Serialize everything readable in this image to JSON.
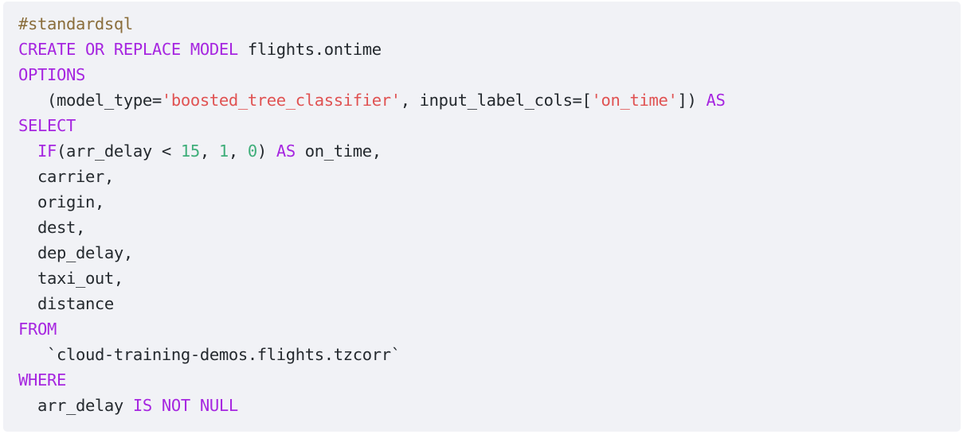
{
  "code_block": {
    "language": "sql",
    "background_color": "#f1f2f6",
    "page_background": "#ffffff",
    "token_colors": {
      "comment": "#8a6d3b",
      "keyword": "#a626e0",
      "identifier": "#6a8bd0",
      "string": "#e05252",
      "number": "#3fae7a",
      "plain": "#24292e"
    },
    "lines": [
      {
        "index": 0,
        "text": "#standardsql",
        "tokens": [
          {
            "t": "#standardsql",
            "k": "comment"
          }
        ]
      },
      {
        "index": 1,
        "text": "CREATE OR REPLACE MODEL flights.ontime",
        "tokens": [
          {
            "t": "CREATE OR REPLACE MODEL",
            "k": "keyword"
          },
          {
            "t": " ",
            "k": "plain"
          },
          {
            "t": "flights.ontime",
            "k": "identifier"
          }
        ]
      },
      {
        "index": 2,
        "text": "OPTIONS",
        "tokens": [
          {
            "t": "OPTIONS",
            "k": "keyword"
          }
        ]
      },
      {
        "index": 3,
        "text": "   (model_type='boosted_tree_classifier', input_label_cols=['on_time']) AS",
        "tokens": [
          {
            "t": "   (model_type=",
            "k": "plain"
          },
          {
            "t": "'boosted_tree_classifier'",
            "k": "string"
          },
          {
            "t": ", input_label_cols=[",
            "k": "plain"
          },
          {
            "t": "'on_time'",
            "k": "string"
          },
          {
            "t": "]) ",
            "k": "plain"
          },
          {
            "t": "AS",
            "k": "keyword"
          }
        ]
      },
      {
        "index": 4,
        "text": "SELECT",
        "tokens": [
          {
            "t": "SELECT",
            "k": "keyword"
          }
        ]
      },
      {
        "index": 5,
        "text": "  IF(arr_delay < 15, 1, 0) AS on_time,",
        "tokens": [
          {
            "t": "  ",
            "k": "plain"
          },
          {
            "t": "IF",
            "k": "keyword"
          },
          {
            "t": "(",
            "k": "plain"
          },
          {
            "t": "arr_delay",
            "k": "identifier"
          },
          {
            "t": " < ",
            "k": "plain"
          },
          {
            "t": "15",
            "k": "number"
          },
          {
            "t": ", ",
            "k": "plain"
          },
          {
            "t": "1",
            "k": "number"
          },
          {
            "t": ", ",
            "k": "plain"
          },
          {
            "t": "0",
            "k": "number"
          },
          {
            "t": ") ",
            "k": "plain"
          },
          {
            "t": "AS",
            "k": "keyword"
          },
          {
            "t": " on_time,",
            "k": "plain"
          }
        ]
      },
      {
        "index": 6,
        "text": "  carrier,",
        "tokens": [
          {
            "t": "  ",
            "k": "plain"
          },
          {
            "t": "carrier",
            "k": "identifier"
          },
          {
            "t": ",",
            "k": "plain"
          }
        ]
      },
      {
        "index": 7,
        "text": "  origin,",
        "tokens": [
          {
            "t": "  ",
            "k": "plain"
          },
          {
            "t": "origin",
            "k": "identifier"
          },
          {
            "t": ",",
            "k": "plain"
          }
        ]
      },
      {
        "index": 8,
        "text": "  dest,",
        "tokens": [
          {
            "t": "  ",
            "k": "plain"
          },
          {
            "t": "dest",
            "k": "identifier"
          },
          {
            "t": ",",
            "k": "plain"
          }
        ]
      },
      {
        "index": 9,
        "text": "  dep_delay,",
        "tokens": [
          {
            "t": "  ",
            "k": "plain"
          },
          {
            "t": "dep_delay",
            "k": "identifier"
          },
          {
            "t": ",",
            "k": "plain"
          }
        ]
      },
      {
        "index": 10,
        "text": "  taxi_out,",
        "tokens": [
          {
            "t": "  ",
            "k": "plain"
          },
          {
            "t": "taxi_out",
            "k": "identifier"
          },
          {
            "t": ",",
            "k": "plain"
          }
        ]
      },
      {
        "index": 11,
        "text": "  distance",
        "tokens": [
          {
            "t": "  ",
            "k": "plain"
          },
          {
            "t": "distance",
            "k": "identifier"
          }
        ]
      },
      {
        "index": 12,
        "text": "FROM",
        "tokens": [
          {
            "t": "FROM",
            "k": "keyword"
          }
        ]
      },
      {
        "index": 13,
        "text": "   `cloud-training-demos.flights.tzcorr`",
        "tokens": [
          {
            "t": "   ",
            "k": "plain"
          },
          {
            "t": "`cloud-training-demos.flights.tzcorr`",
            "k": "identifier"
          }
        ]
      },
      {
        "index": 14,
        "text": "WHERE",
        "tokens": [
          {
            "t": "WHERE",
            "k": "keyword"
          }
        ]
      },
      {
        "index": 15,
        "text": "  arr_delay IS NOT NULL",
        "tokens": [
          {
            "t": "  ",
            "k": "plain"
          },
          {
            "t": "arr_delay",
            "k": "identifier"
          },
          {
            "t": " ",
            "k": "plain"
          },
          {
            "t": "IS NOT NULL",
            "k": "keyword"
          }
        ]
      }
    ]
  }
}
